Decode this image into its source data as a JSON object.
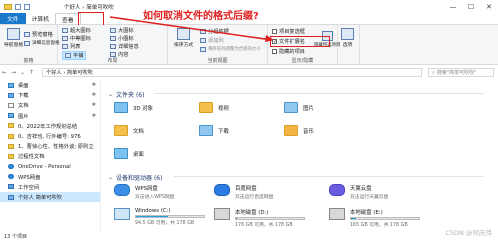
{
  "titlebar": {
    "title": "个好人  ›  简单可吹吹",
    "min": "—",
    "max": "☐",
    "close": "✕"
  },
  "tabs": [
    {
      "label": "文件"
    },
    {
      "label": "计算机"
    },
    {
      "label": "查看"
    }
  ],
  "annotation": "如何取消文件的格式后缀?",
  "ribbon": {
    "pane_group": {
      "nav_pane": "导航窗格",
      "preview_pane": "预览窗格",
      "details_pane": "详细信息窗格",
      "label": "窗格"
    },
    "layout_group": {
      "items": [
        "超大图标",
        "大图标",
        "中等图标",
        "小图标",
        "列表",
        "详细信息",
        "平铺",
        "内容"
      ],
      "label": "布局"
    },
    "view_group": {
      "sort_by": "排序方式",
      "group_by": "分组依据",
      "add_columns": "添加列",
      "fit_columns": "将所有列调整为合适的大小",
      "label": "当前视图"
    },
    "showhide_group": {
      "item_checkboxes": "项目复选框",
      "file_extensions": "文件扩展名",
      "hidden_items": "隐藏的项目",
      "hide_selected": "隐藏所选项目",
      "label": "显示/隐藏"
    },
    "options": "选项"
  },
  "address": {
    "path": "个好人  ›  简单可吹吹",
    "search_placeholder": "搜索\"简单可吹吹\""
  },
  "sidebar": {
    "items": [
      {
        "label": "桌面",
        "icon": "desktop-icon",
        "pinned": true
      },
      {
        "label": "下载",
        "icon": "download-icon",
        "pinned": true
      },
      {
        "label": "文档",
        "icon": "docs-icon",
        "pinned": true
      },
      {
        "label": "图片",
        "icon": "pictures-icon",
        "pinned": true
      },
      {
        "label": "0、2022年工作规划总结",
        "icon": "folder-icon",
        "pinned": false
      },
      {
        "label": "0、吉祥也, 行外编号: 976",
        "icon": "folder-icon",
        "pinned": false
      },
      {
        "label": "1、曹徐心性、性格外谈; 原则立",
        "icon": "folder-icon",
        "pinned": false
      },
      {
        "label": "过程性文档",
        "icon": "folder-icon",
        "pinned": false
      },
      {
        "label": "OneDrive - Personal",
        "icon": "onedrive-icon",
        "pinned": false
      },
      {
        "label": "WPS网盘",
        "icon": "wps-cloud-icon",
        "pinned": false
      },
      {
        "label": "工作空间",
        "icon": "workspace-icon",
        "pinned": false
      },
      {
        "label": "个好人  简单可吹吹",
        "icon": "pc-icon",
        "pinned": false,
        "selected": true
      }
    ]
  },
  "main": {
    "folders_header": "文件夹 (6)",
    "folders": [
      {
        "label": "3D 对象",
        "icon": "3d-objects-icon"
      },
      {
        "label": "视频",
        "icon": "videos-icon"
      },
      {
        "label": "图片",
        "icon": "pictures-folder-icon"
      },
      {
        "label": "文档",
        "icon": "documents-folder-icon"
      },
      {
        "label": "下载",
        "icon": "downloads-folder-icon"
      },
      {
        "label": "音乐",
        "icon": "music-folder-icon"
      },
      {
        "label": "桌面",
        "icon": "desktop-folder-icon"
      }
    ],
    "devices_header": "设备和驱动器 (6)",
    "devices": [
      {
        "name": "WPS网盘",
        "sub": "双击进入WPS网盘",
        "icon": "wps-drive-icon"
      },
      {
        "name": "百度网盘",
        "sub": "双击运行百度网盘",
        "icon": "baidu-drive-icon"
      },
      {
        "name": "天翼云盘",
        "sub": "双击运行天翼云盘",
        "icon": "tianyi-drive-icon"
      },
      {
        "name": "Windows (C:)",
        "sub": "94.5 GB 可用，共 178 GB",
        "icon": "windows-drive-icon",
        "used": 0.47
      },
      {
        "name": "本地磁盘 (D:)",
        "sub": "176 GB 可用，共 178 GB",
        "icon": "local-disk-d-icon",
        "used": 0.01
      },
      {
        "name": "本地磁盘 (E:)",
        "sub": "165 GB 可用，共 178 GB",
        "icon": "local-disk-e-icon",
        "used": 0.07
      }
    ]
  },
  "status": {
    "count": "13 个项目"
  },
  "watermark": "CSDN @何庆伟"
}
